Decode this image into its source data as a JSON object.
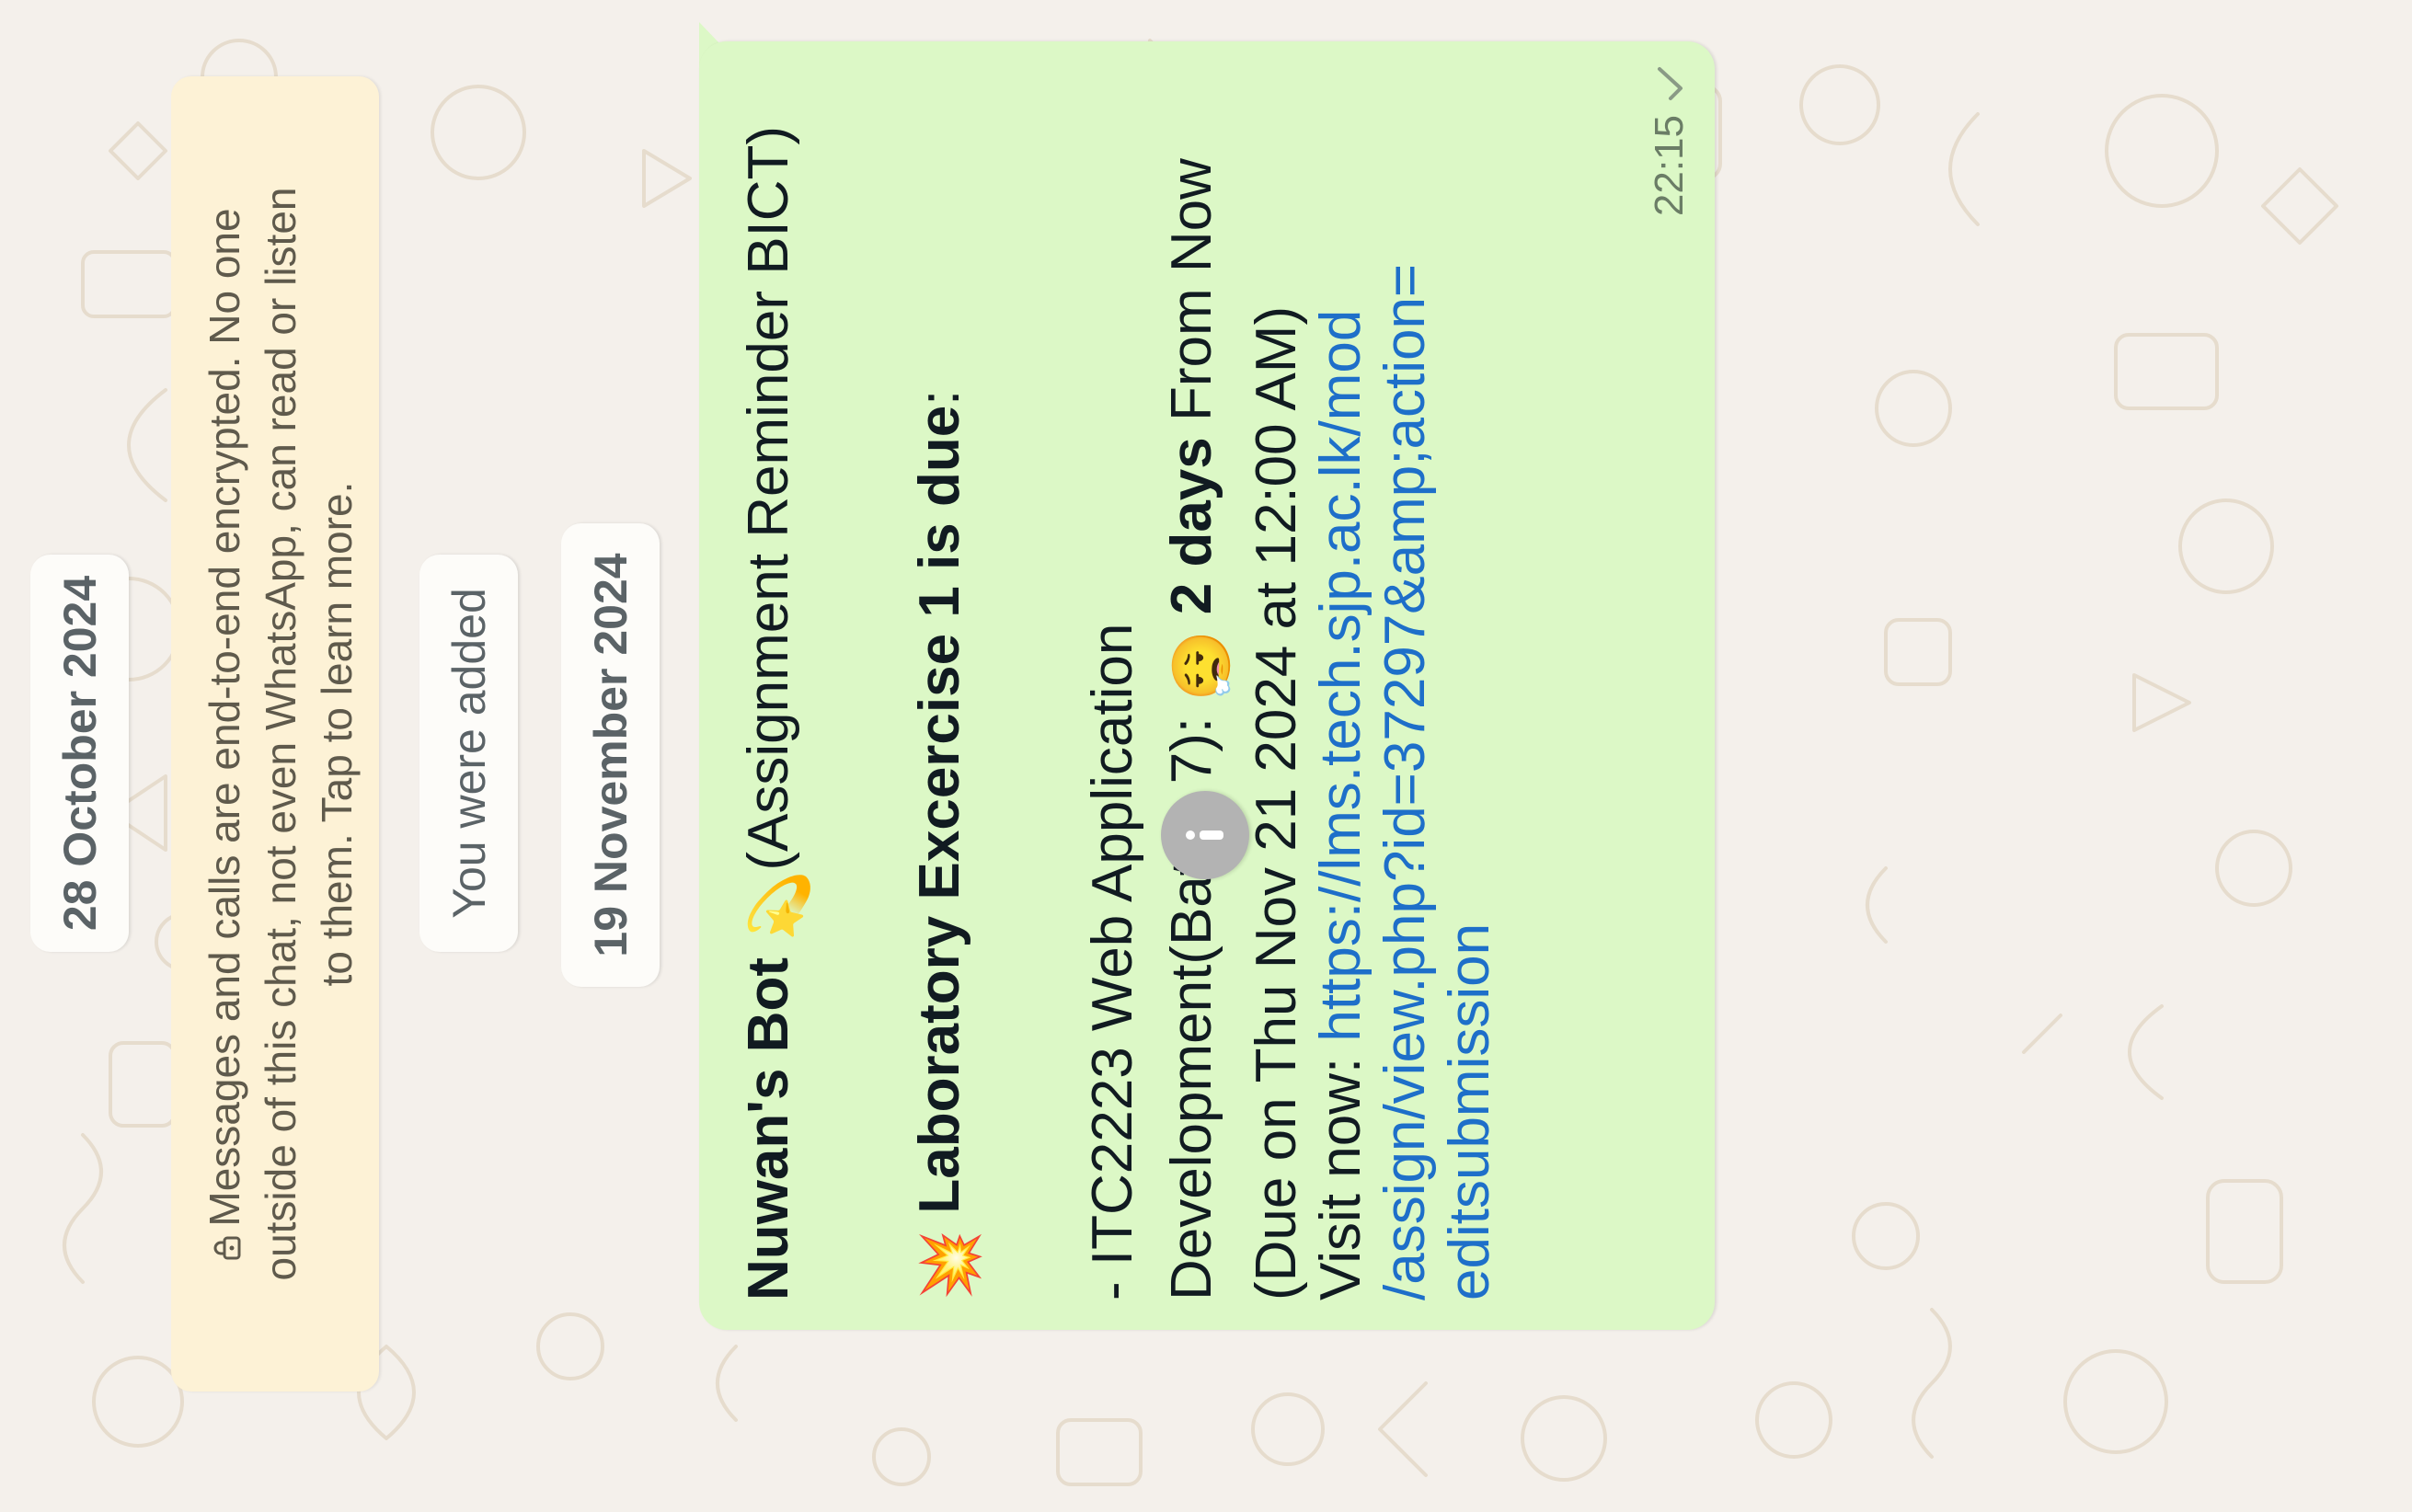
{
  "chat": {
    "date_1": "28 October 2024",
    "encryption_notice": {
      "line_1": "Messages and calls are end-to-end encrypted. No one",
      "line_2": "outside of this chat, not even WhatsApp, can read or listen",
      "line_3": "to them. Tap to learn more.",
      "icon": "lock-icon"
    },
    "system_added": "You were added",
    "date_2": "19 November 2024"
  },
  "message": {
    "sender": "Nuwan's Bot",
    "sender_emoji": "💫",
    "sender_suffix": "(Assignment Reminder BICT)",
    "heading_emoji": "💥",
    "heading": "Laboratory Excercise 1 is due",
    "heading_colon": ":",
    "course_line_1": "- ITC2223 Web Application",
    "course_line_2": "Development(Batch 7):",
    "course_emoji": "😮‍💨",
    "due_bold": "2 days",
    "due_suffix": " From Now",
    "due_date": "(Due on Thu Nov 21 2024 at 12:00 AM)",
    "visit_label": "Visit now: ",
    "link_line_1": "https://lms.tech.sjp.ac.lk/mod",
    "link_line_2": "/assign/view.php?id=37297&amp;action=",
    "link_line_3": "editsubmission",
    "time": "22:15",
    "status_icon": "single-check-icon"
  },
  "info_button": {
    "icon": "info-icon"
  },
  "colors": {
    "wallpaper": "#f4f0eb",
    "outgoing_bubble": "#dcf8c6",
    "notice_bg": "#fdf2d6",
    "link": "#1e6fc9"
  }
}
